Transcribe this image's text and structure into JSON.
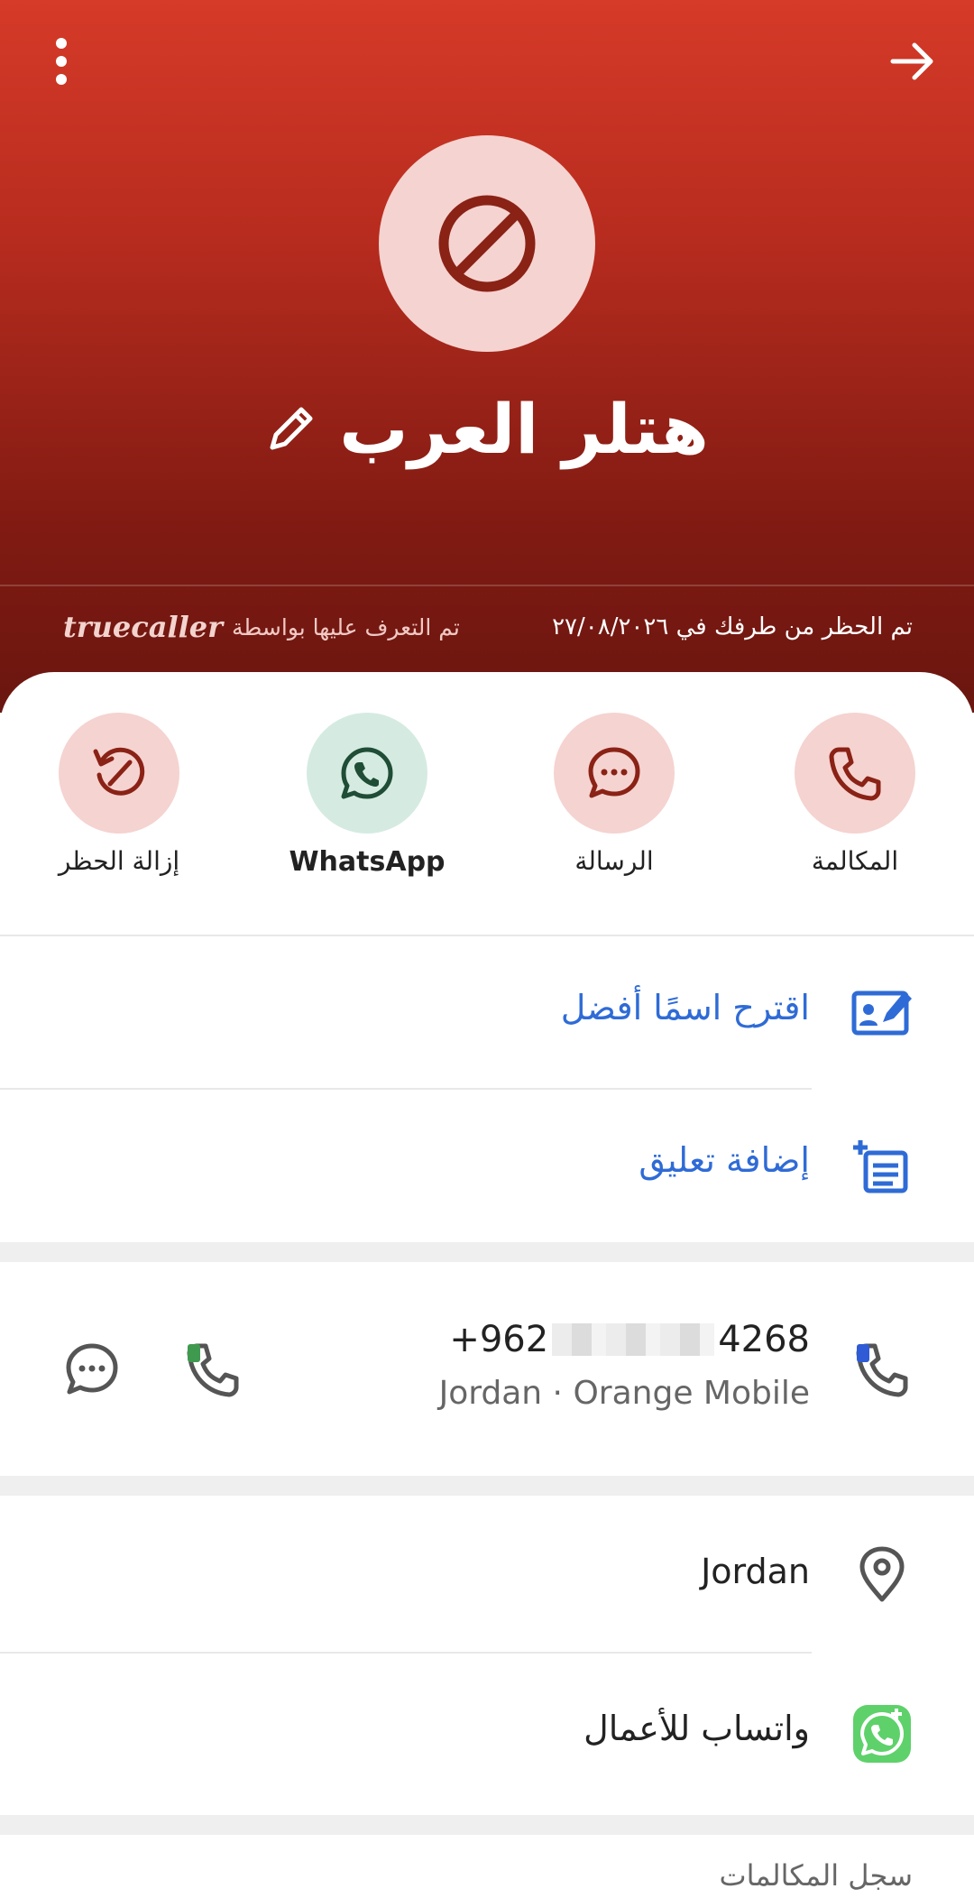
{
  "header": {
    "contact_name": "هتلر العرب",
    "identified_by": "تم التعرف عليها بواسطة",
    "brand": "truecaller",
    "blocked_by_you": "تم الحظر من طرفك في ٢٧/٠٨/٢٠٢٦",
    "icons": [
      "more-vert-icon",
      "arrow-forward-icon",
      "block-icon",
      "edit-pencil-icon"
    ]
  },
  "actions": [
    {
      "label": "المكالمة",
      "icon": "phone-icon"
    },
    {
      "label": "الرسالة",
      "icon": "message-icon"
    },
    {
      "label": "WhatsApp",
      "icon": "whatsapp-icon"
    },
    {
      "label": "إزالة الحظر",
      "icon": "unblock-icon"
    }
  ],
  "suggest": {
    "label": "اقترح اسمًا أفضل",
    "icon": "edit-contact-icon"
  },
  "comment": {
    "label": "إضافة تعليق",
    "icon": "add-note-icon"
  },
  "phone": {
    "number_prefix": "+962",
    "number_suffix": "4268",
    "subtitle": "Jordan · Orange Mobile"
  },
  "location": {
    "label": "Jordan",
    "icon": "location-pin-icon"
  },
  "whatsapp_business": {
    "label": "واتساب للأعمال",
    "icon": "whatsapp-business-icon"
  },
  "call_history": {
    "label": "سجل المكالمات"
  },
  "colors": {
    "header_red": "#d63a28",
    "header_dark": "#6a1610",
    "accent_blue": "#2f6bd6",
    "action_pink": "#f5d3d0",
    "action_mint": "#d5ebe1",
    "whatsapp_green": "#5ed16b"
  }
}
